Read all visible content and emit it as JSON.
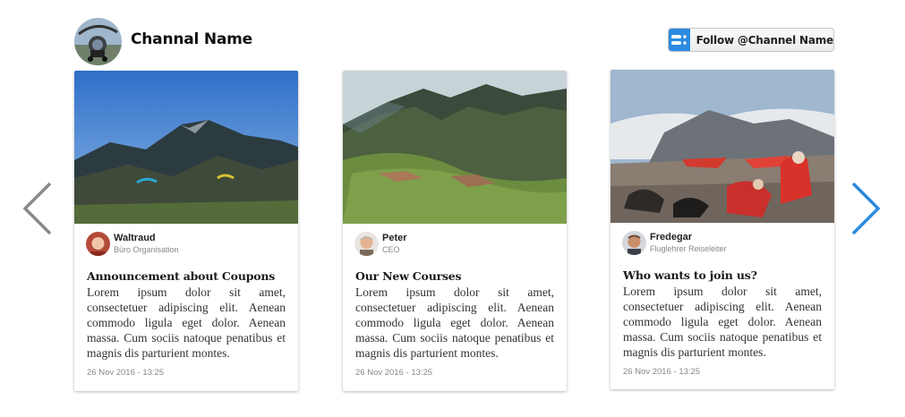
{
  "channel": {
    "name": "Channal Name",
    "follow_label": "Follow @Channel Name"
  },
  "colors": {
    "accent": "#2b8ae2",
    "arrow_inactive": "#888888"
  },
  "nav": {
    "prev_icon": "chevron-left-icon",
    "next_icon": "chevron-right-icon"
  },
  "posts": [
    {
      "author": "Waltraud",
      "role": "Büro Organisation",
      "title": "Announcement about Coupons",
      "body": "Lorem ipsum dolor sit amet, consectetuer adipiscing elit. Aenean commodo ligula eget dolor. Aenean massa. Cum sociis natoque penatibus et magnis dis parturient montes.",
      "date": "26 Nov 2016 - 13:25"
    },
    {
      "author": "Peter",
      "role": "CEO",
      "title": "Our New Courses",
      "body": "Lorem ipsum dolor sit amet, consectetuer adipiscing elit. Aenean commodo ligula eget dolor. Aenean massa. Cum sociis natoque penatibus et magnis dis parturient montes.",
      "date": "26 Nov 2016 - 13:25"
    },
    {
      "author": "Fredegar",
      "role": "Fluglehrer Reiseleiter",
      "title": "Who wants to join us?",
      "body": "Lorem ipsum dolor sit amet, consectetuer adipiscing elit. Aenean commodo ligula eget dolor. Aenean massa. Cum sociis natoque penatibus et magnis dis parturient montes.",
      "date": "26 Nov 2016 - 13:25"
    }
  ]
}
